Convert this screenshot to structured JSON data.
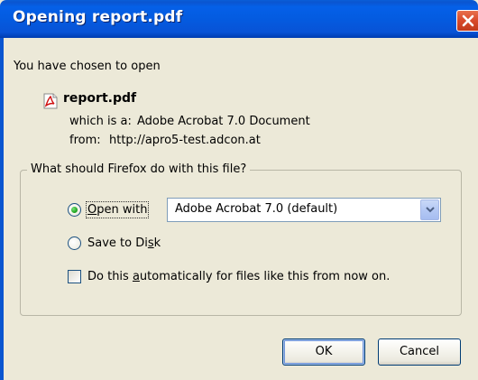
{
  "window": {
    "title": "Opening report.pdf"
  },
  "intro_text": "You have chosen to open",
  "file": {
    "name": "report.pdf",
    "type_label": "which is a:",
    "type_value": "Adobe Acrobat 7.0 Document",
    "from_label": "from:",
    "from_value": "http://apro5-test.adcon.at",
    "icon": "pdf-file-icon"
  },
  "options": {
    "legend": "What should Firefox do with this file?",
    "open_with": {
      "label_pre": "",
      "label_access": "O",
      "label_post": "pen with",
      "selected": true
    },
    "application": {
      "value": "Adobe Acrobat 7.0 (default)"
    },
    "save_to_disk": {
      "label_pre": "Save to Di",
      "label_access": "s",
      "label_post": "k",
      "selected": false
    },
    "auto_checkbox": {
      "label_pre": "Do this ",
      "label_access": "a",
      "label_post": "utomatically for files like this from now on.",
      "checked": false
    }
  },
  "buttons": {
    "ok": "OK",
    "cancel": "Cancel"
  },
  "colors": {
    "title_bar": "#0a5ed8",
    "dialog_bg": "#ece9d8",
    "close_button": "#d8492a"
  }
}
